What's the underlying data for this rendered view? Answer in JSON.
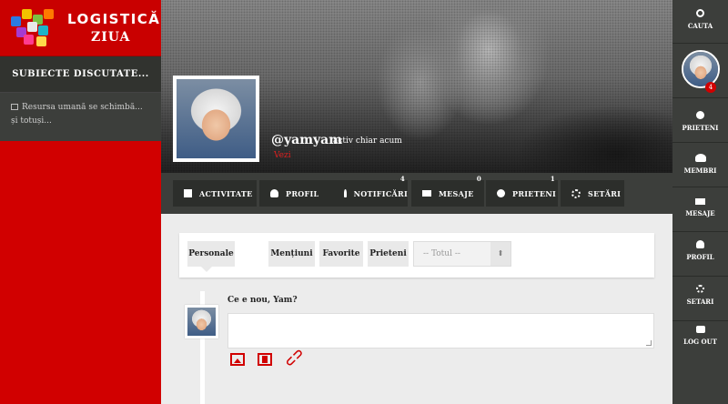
{
  "brand": {
    "line1": "LOGISTICĂ",
    "line2": "ZIUA"
  },
  "sidebar": {
    "heading": "SUBIECTE DISCUTATE...",
    "items": [
      {
        "label": "Resursa umană se schimbă... și totuși..."
      }
    ]
  },
  "profile": {
    "username": "@yamyam",
    "activity": "activ chiar acum",
    "view_link": "Vezi"
  },
  "nav": {
    "items": [
      {
        "label": "ACTIVITATE",
        "icon": "activity-icon",
        "badge": ""
      },
      {
        "label": "PROFIL",
        "icon": "user-icon",
        "badge": ""
      },
      {
        "label": "NOTIFICĂRI",
        "icon": "bell-icon",
        "badge": "4"
      },
      {
        "label": "MESAJE",
        "icon": "envelope-icon",
        "badge": "0"
      },
      {
        "label": "PRIETENI",
        "icon": "paw-icon",
        "badge": "1"
      },
      {
        "label": "SETĂRI",
        "icon": "gear-icon",
        "badge": ""
      }
    ]
  },
  "filters": {
    "tabs": [
      "Personale",
      "Mențiuni",
      "Favorite",
      "Prieteni"
    ],
    "select_value": "-- Totul --"
  },
  "post": {
    "prompt": "Ce e nou, Yam?"
  },
  "right_nav": {
    "search": "CAUTA",
    "avatar_badge": "4",
    "friends": "PRIETENI",
    "members": "MEMBRI",
    "messages": "MESAJE",
    "profile": "PROFIL",
    "settings": "SETARI",
    "logout": "LOG OUT"
  },
  "colors": {
    "accent": "#d10000",
    "dark": "#3c3e3b"
  }
}
